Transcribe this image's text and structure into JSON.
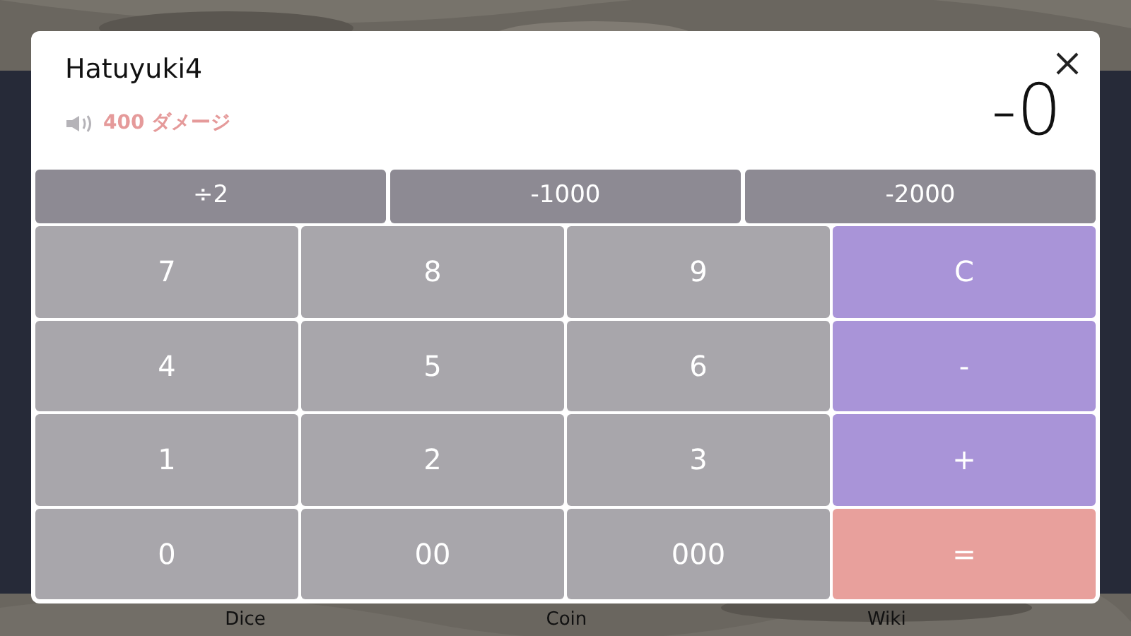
{
  "dialog": {
    "title": "Hatuyuki4",
    "damage": "400 ダメージ",
    "display": "-0"
  },
  "quick_buttons": [
    "÷2",
    "-1000",
    "-2000"
  ],
  "keys": [
    {
      "label": "7",
      "kind": "number"
    },
    {
      "label": "8",
      "kind": "number"
    },
    {
      "label": "9",
      "kind": "number"
    },
    {
      "label": "C",
      "kind": "operator"
    },
    {
      "label": "4",
      "kind": "number"
    },
    {
      "label": "5",
      "kind": "number"
    },
    {
      "label": "6",
      "kind": "number"
    },
    {
      "label": "-",
      "kind": "operator"
    },
    {
      "label": "1",
      "kind": "number"
    },
    {
      "label": "2",
      "kind": "number"
    },
    {
      "label": "3",
      "kind": "number"
    },
    {
      "label": "+",
      "kind": "operator"
    },
    {
      "label": "0",
      "kind": "number"
    },
    {
      "label": "00",
      "kind": "number"
    },
    {
      "label": "000",
      "kind": "number"
    },
    {
      "label": "=",
      "kind": "equals"
    }
  ],
  "bottom_tabs": [
    "Dice",
    "Coin",
    "Wiki"
  ]
}
